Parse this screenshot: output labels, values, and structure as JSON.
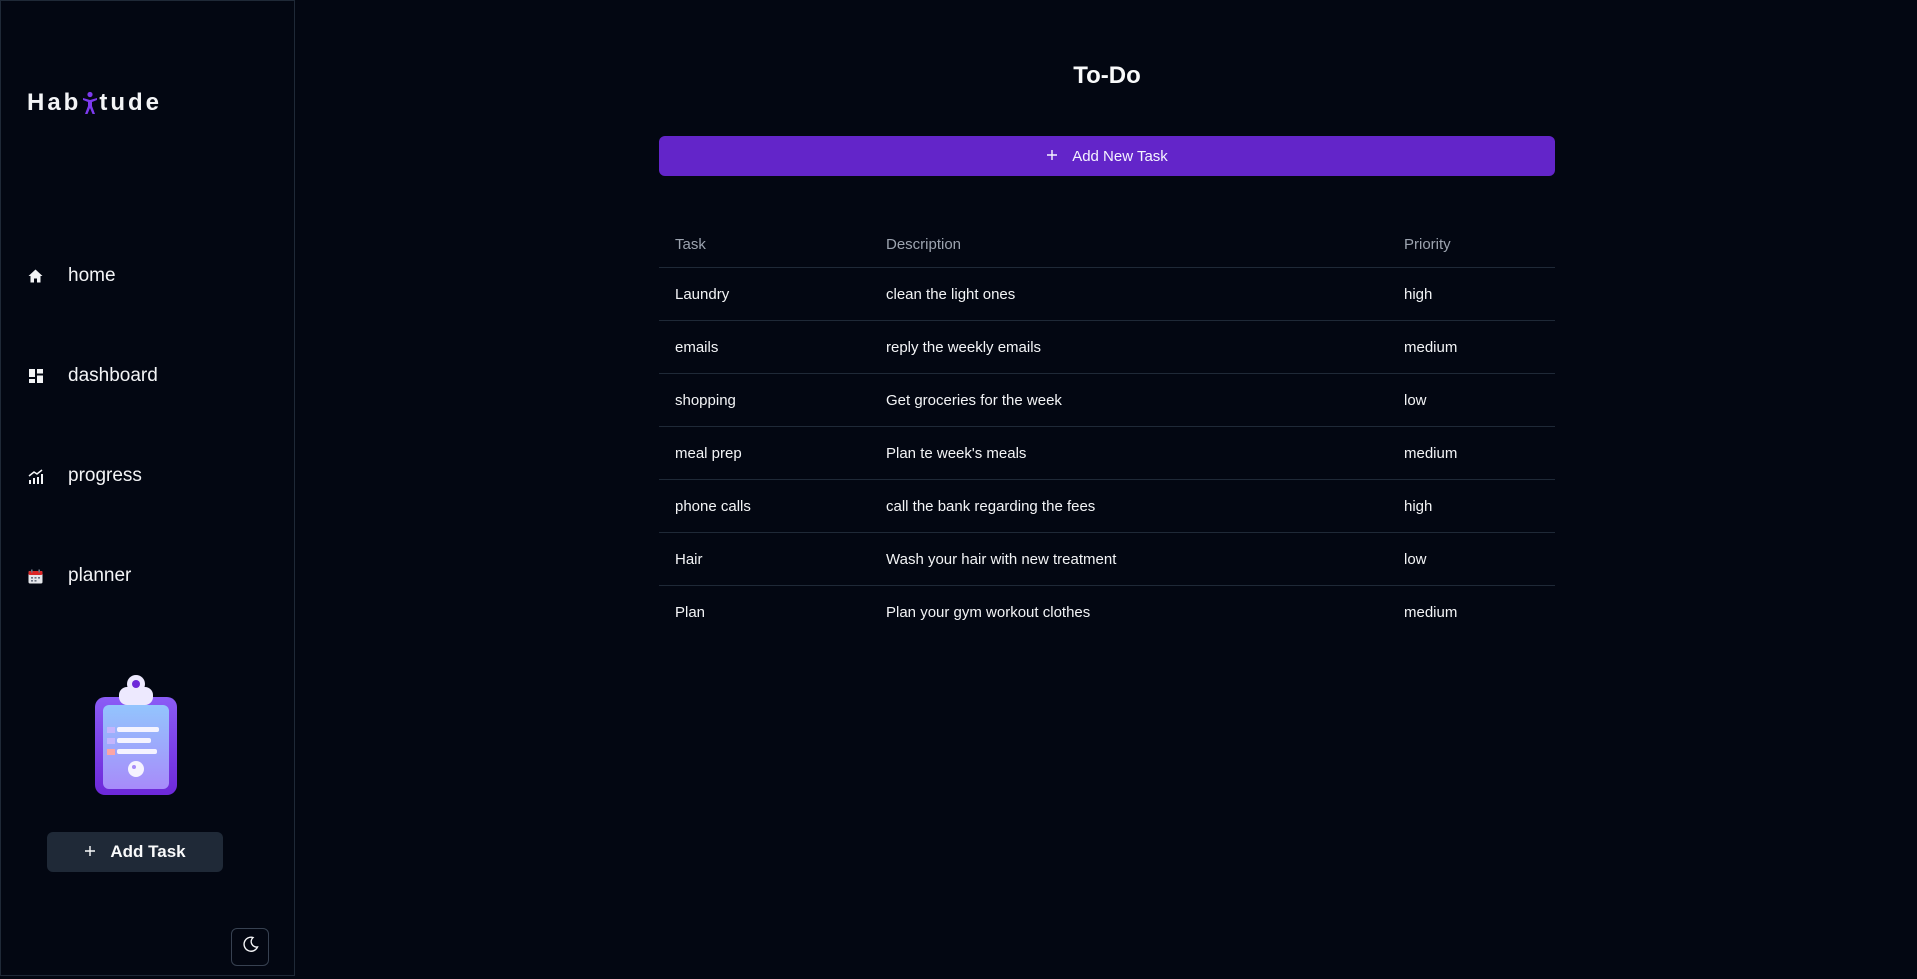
{
  "app": {
    "logo_left": "Hab",
    "logo_right": "tude"
  },
  "sidebar": {
    "items": [
      {
        "label": "home",
        "icon": "home-icon"
      },
      {
        "label": "dashboard",
        "icon": "dashboard-icon"
      },
      {
        "label": "progress",
        "icon": "progress-icon"
      },
      {
        "label": "planner",
        "icon": "calendar-icon"
      }
    ],
    "add_task_label": "Add Task",
    "illustration": "clipboard-icon",
    "theme_icon": "moon-icon"
  },
  "main": {
    "title": "To-Do",
    "add_new_label": "Add New Task",
    "table": {
      "headers": [
        "Task",
        "Description",
        "Priority"
      ],
      "rows": [
        [
          "Laundry",
          "clean the light ones",
          "high"
        ],
        [
          "emails",
          "reply the weekly emails",
          "medium"
        ],
        [
          "shopping",
          "Get groceries for the week",
          "low"
        ],
        [
          "meal prep",
          "Plan te week's meals",
          "medium"
        ],
        [
          "phone calls",
          "call the bank regarding the fees",
          "high"
        ],
        [
          "Hair",
          "Wash your hair with new treatment",
          "low"
        ],
        [
          "Plan",
          "Plan your gym workout clothes",
          "medium"
        ]
      ]
    }
  },
  "colors": {
    "background": "#030712",
    "accent": "#6325c9",
    "border": "#1f2937",
    "muted_text": "#9ca3af"
  }
}
